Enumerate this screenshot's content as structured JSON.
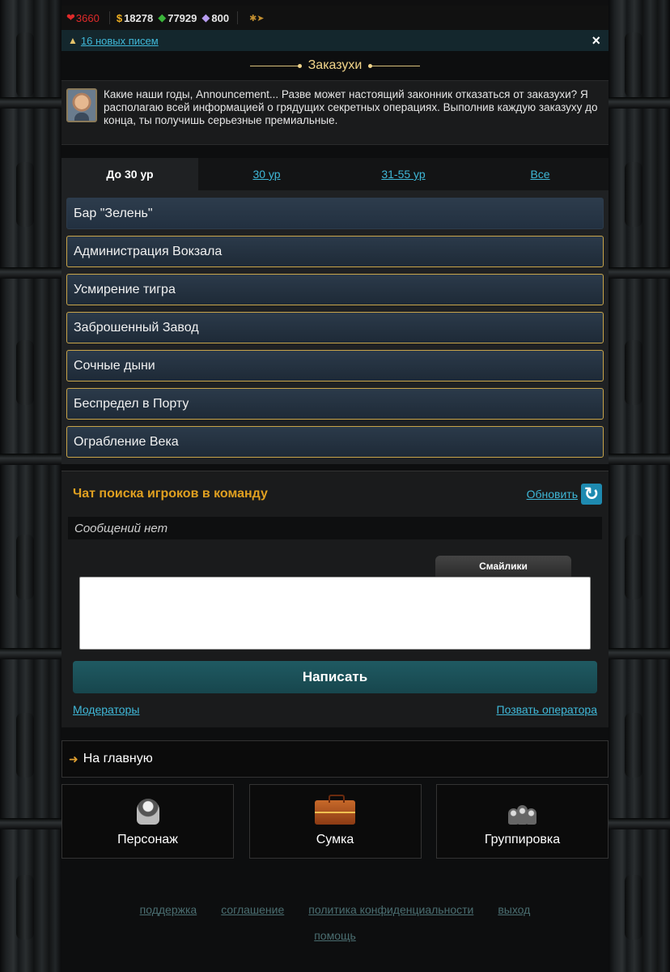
{
  "status": {
    "hp": "3660",
    "money": "18278",
    "gems": "77929",
    "crystals": "800"
  },
  "mail": {
    "link": "16 новых писем",
    "close": "×"
  },
  "section": {
    "title": "Заказухи"
  },
  "intro": {
    "text": "Какие наши годы, Announcement... Разве может настоящий законник отказаться от заказухи? Я располагаю всей информацией о грядущих секретных операциях. Выполнив каждую заказуху до конца, ты получишь серьезные премиальные."
  },
  "tabs": [
    {
      "label": "До 30 ур",
      "active": true
    },
    {
      "label": "30 ур",
      "active": false
    },
    {
      "label": "31-55 ур",
      "active": false
    },
    {
      "label": "Все",
      "active": false
    }
  ],
  "quests": [
    "Бар \"Зелень\"",
    "Администрация Вокзала",
    "Усмирение тигра",
    "Заброшенный Завод",
    "Сочные дыни",
    "Беспредел в Порту",
    "Ограбление Века"
  ],
  "chat": {
    "title": "Чат поиска игроков в команду",
    "refresh": "Обновить",
    "empty": "Сообщений нет",
    "smiles": "Смайлики",
    "write": "Написать",
    "moderators": "Модераторы",
    "call_operator": "Позвать оператора"
  },
  "home": {
    "label": "На главную"
  },
  "nav": [
    {
      "label": "Персонаж",
      "icon": "character-icon"
    },
    {
      "label": "Сумка",
      "icon": "bag-icon"
    },
    {
      "label": "Группировка",
      "icon": "group-icon"
    }
  ],
  "footer": {
    "support": "поддержка",
    "agreement": "соглашение",
    "privacy": "политика конфиденциальности",
    "logout": "выход",
    "help": "помощь"
  },
  "colors": {
    "accent_link": "#3fb8d8",
    "title_gold": "#f2d58a",
    "chat_title": "#e0a020",
    "quest_border": "#c8a44a"
  }
}
